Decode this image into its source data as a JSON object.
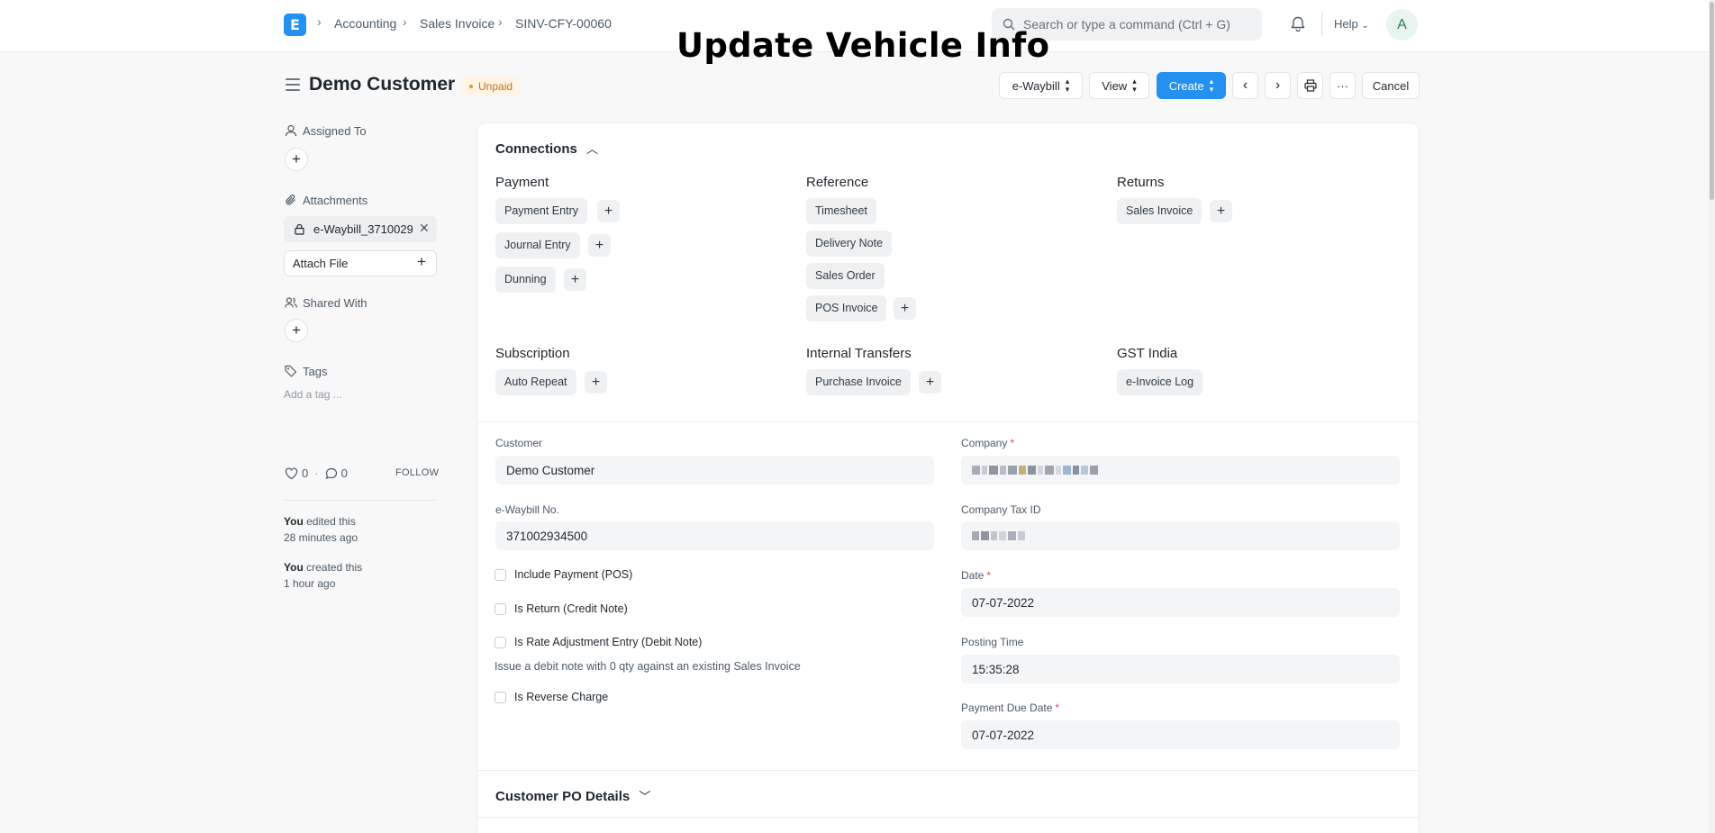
{
  "overlay_title": "Update Vehicle Info",
  "navbar": {
    "logo_letter": "E",
    "breadcrumbs": [
      "Accounting",
      "Sales Invoice",
      "SINV-CFY-00060"
    ],
    "search_placeholder": "Search or type a command (Ctrl + G)",
    "help_label": "Help",
    "avatar_letter": "A"
  },
  "page": {
    "title": "Demo Customer",
    "status": "Unpaid",
    "actions": {
      "ewaybill": "e-Waybill",
      "view": "View",
      "create": "Create",
      "cancel": "Cancel",
      "more": "···"
    }
  },
  "sidebar": {
    "assigned_to": "Assigned To",
    "attachments": "Attachments",
    "attachment_file": "e-Waybill_371002934500",
    "attach_file": "Attach File",
    "shared_with": "Shared With",
    "tags": "Tags",
    "tag_placeholder": "Add a tag ...",
    "likes": "0",
    "comments": "0",
    "follow": "FOLLOW",
    "activity": [
      {
        "who": "You",
        "what": " edited this",
        "when": "28 minutes ago"
      },
      {
        "who": "You",
        "what": " created this",
        "when": "1 hour ago"
      }
    ]
  },
  "connections": {
    "title": "Connections",
    "groups": [
      {
        "name": "Payment",
        "items": [
          {
            "label": "Payment Entry",
            "addable": true
          },
          {
            "label": "Journal Entry",
            "addable": true
          },
          {
            "label": "Dunning",
            "addable": true
          }
        ]
      },
      {
        "name": "Reference",
        "items": [
          {
            "label": "Timesheet",
            "addable": false
          },
          {
            "label": "Delivery Note",
            "addable": false
          },
          {
            "label": "Sales Order",
            "addable": false
          },
          {
            "label": "POS Invoice",
            "addable": true
          }
        ]
      },
      {
        "name": "Returns",
        "items": [
          {
            "label": "Sales Invoice",
            "addable": true
          }
        ]
      },
      {
        "name": "Subscription",
        "items": [
          {
            "label": "Auto Repeat",
            "addable": true
          }
        ]
      },
      {
        "name": "Internal Transfers",
        "items": [
          {
            "label": "Purchase Invoice",
            "addable": true
          }
        ]
      },
      {
        "name": "GST India",
        "items": [
          {
            "label": "e-Invoice Log",
            "addable": false
          }
        ]
      }
    ]
  },
  "form": {
    "customer_label": "Customer",
    "customer_value": "Demo Customer",
    "ewaybill_label": "e-Waybill No.",
    "ewaybill_value": "371002934500",
    "checks": [
      "Include Payment (POS)",
      "Is Return (Credit Note)",
      "Is Rate Adjustment Entry (Debit Note)",
      "Is Reverse Charge"
    ],
    "rate_adjust_help": "Issue a debit note with 0 qty against an existing Sales Invoice",
    "company_label": "Company",
    "company_tax_label": "Company Tax ID",
    "date_label": "Date",
    "date_value": "07-07-2022",
    "posting_time_label": "Posting Time",
    "posting_time_value": "15:35:28",
    "due_date_label": "Payment Due Date",
    "due_date_value": "07-07-2022",
    "required_mark": "*"
  },
  "customer_po": {
    "title": "Customer PO Details"
  },
  "colors": {
    "primary": "#2490ef",
    "status_unpaid": "#cb6e17"
  }
}
